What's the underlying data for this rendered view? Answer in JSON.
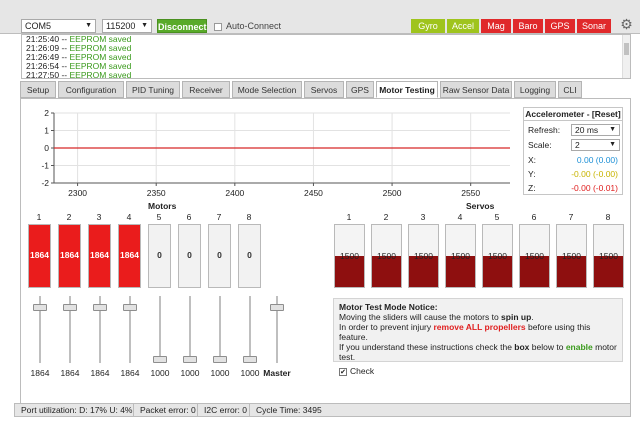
{
  "toolbar": {
    "port": "COM5",
    "baud": "115200",
    "disconnect_label": "Disconnect",
    "autoconnect_label": "Auto-Connect",
    "sensors": [
      {
        "label": "Gyro",
        "color": "#9fc41d"
      },
      {
        "label": "Accel",
        "color": "#9fc41d"
      },
      {
        "label": "Mag",
        "color": "#e0292b"
      },
      {
        "label": "Baro",
        "color": "#e0292b"
      },
      {
        "label": "GPS",
        "color": "#e0292b"
      },
      {
        "label": "Sonar",
        "color": "#e0292b"
      }
    ]
  },
  "log": {
    "lines": [
      {
        "time": "21:25:40",
        "text": "EEPROM saved"
      },
      {
        "time": "21:26:09",
        "text": "EEPROM saved"
      },
      {
        "time": "21:26:49",
        "text": "EEPROM saved"
      },
      {
        "time": "21:26:54",
        "text": "EEPROM saved"
      },
      {
        "time": "21:27:50",
        "text": "EEPROM saved"
      }
    ]
  },
  "tabs": [
    {
      "label": "Setup",
      "active": false
    },
    {
      "label": "Configuration",
      "active": false
    },
    {
      "label": "PID Tuning",
      "active": false
    },
    {
      "label": "Receiver",
      "active": false
    },
    {
      "label": "Mode Selection",
      "active": false
    },
    {
      "label": "Servos",
      "active": false
    },
    {
      "label": "GPS",
      "active": false
    },
    {
      "label": "Motor Testing",
      "active": true
    },
    {
      "label": "Raw Sensor Data",
      "active": false
    },
    {
      "label": "Logging",
      "active": false
    },
    {
      "label": "CLI",
      "active": false
    }
  ],
  "chart_data": {
    "type": "line",
    "x_ticks": [
      2300,
      2350,
      2400,
      2450,
      2500,
      2550
    ],
    "y_ticks": [
      2,
      1,
      0,
      -1,
      -2
    ],
    "xlim": [
      2285,
      2575
    ],
    "ylim": [
      -2,
      2
    ],
    "series": [
      {
        "color": "#d62728",
        "x": [
          2285,
          2575
        ],
        "y": [
          0,
          0
        ]
      }
    ]
  },
  "accelerometer": {
    "title": "Accelerometer - [Reset]",
    "refresh_label": "Refresh:",
    "refresh_value": "20 ms",
    "scale_label": "Scale:",
    "scale_value": "2",
    "x_label": "X:",
    "x_value": "0.00 (0.00)",
    "x_color": "#1e90d6",
    "y_label": "Y:",
    "y_value": "-0.00 (-0.00)",
    "y_color": "#c8b400",
    "z_label": "Z:",
    "z_value": "-0.00 (-0.01)",
    "z_color": "#e02020"
  },
  "motors": {
    "title": "Motors",
    "items": [
      {
        "index": "1",
        "value": "1864",
        "level": 1.0
      },
      {
        "index": "2",
        "value": "1864",
        "level": 1.0
      },
      {
        "index": "3",
        "value": "1864",
        "level": 1.0
      },
      {
        "index": "4",
        "value": "1864",
        "level": 1.0
      },
      {
        "index": "5",
        "value": "0",
        "level": 0
      },
      {
        "index": "6",
        "value": "0",
        "level": 0
      },
      {
        "index": "7",
        "value": "0",
        "level": 0
      },
      {
        "index": "8",
        "value": "0",
        "level": 0
      }
    ]
  },
  "servos": {
    "title": "Servos",
    "items": [
      {
        "index": "1",
        "value": "1500",
        "level": 0.5
      },
      {
        "index": "2",
        "value": "1500",
        "level": 0.5
      },
      {
        "index": "3",
        "value": "1500",
        "level": 0.5
      },
      {
        "index": "4",
        "value": "1500",
        "level": 0.5
      },
      {
        "index": "5",
        "value": "1500",
        "level": 0.5
      },
      {
        "index": "6",
        "value": "1500",
        "level": 0.5
      },
      {
        "index": "7",
        "value": "1500",
        "level": 0.5
      },
      {
        "index": "8",
        "value": "1500",
        "level": 0.5
      }
    ]
  },
  "sliders": {
    "items": [
      {
        "label": "1864",
        "level": 0.86
      },
      {
        "label": "1864",
        "level": 0.86
      },
      {
        "label": "1864",
        "level": 0.86
      },
      {
        "label": "1864",
        "level": 0.86
      },
      {
        "label": "1000",
        "level": 0
      },
      {
        "label": "1000",
        "level": 0
      },
      {
        "label": "1000",
        "level": 0
      },
      {
        "label": "1000",
        "level": 0
      }
    ],
    "master_label": "Master",
    "master_level": 0.86
  },
  "notice": {
    "title": "Motor Test Mode Notice:",
    "line1_a": "Moving the sliders will cause the motors to ",
    "line1_b": "spin up",
    "line1_c": ".",
    "line2_a": "In order to prevent injury ",
    "line2_b": "remove ALL propellers",
    "line2_c": " before using this feature.",
    "line3_a": "If you understand these instructions check the ",
    "line3_b": "box",
    "line3_c": " below to ",
    "line3_d": "enable",
    "line3_e": " motor test.",
    "check_label": "Check",
    "checked": true
  },
  "status": {
    "port_util": "Port utilization: D: 17% U: 4%",
    "packet_error": "Packet error: 0",
    "i2c_error": "I2C error: 0",
    "cycle_time": "Cycle Time: 3495"
  }
}
